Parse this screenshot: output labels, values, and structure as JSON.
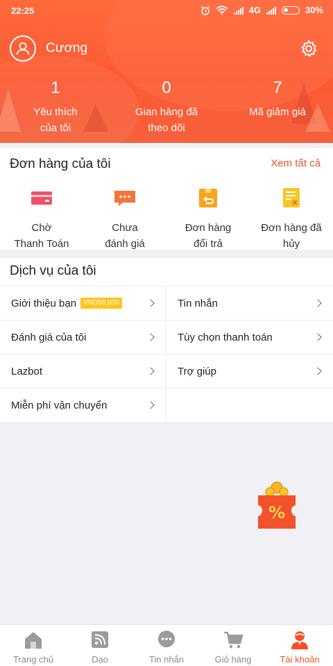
{
  "status_bar": {
    "time": "22:25",
    "network": "4G",
    "battery": "30%"
  },
  "header": {
    "username": "Cương",
    "stats": [
      {
        "value": "1",
        "label_line1": "Yêu thích",
        "label_line2": "của tôi"
      },
      {
        "value": "0",
        "label_line1": "Gian hàng đã",
        "label_line2": "theo dõi"
      },
      {
        "value": "7",
        "label_line1": "Mã giảm giá",
        "label_line2": ""
      }
    ]
  },
  "orders": {
    "title": "Đơn hàng của tôi",
    "see_all": "Xem tất cả",
    "items": [
      {
        "line1": "Chờ",
        "line2": "Thanh Toán",
        "icon": "card-icon"
      },
      {
        "line1": "Chưa",
        "line2": "đánh giá",
        "icon": "chat-icon"
      },
      {
        "line1": "Đơn hàng",
        "line2": "đổi trả",
        "icon": "return-box-icon"
      },
      {
        "line1": "Đơn hàng đã",
        "line2": "hủy",
        "icon": "cancelled-doc-icon"
      }
    ]
  },
  "services": {
    "title": "Dịch vụ của tôi",
    "items": [
      {
        "label": "Giới thiệu bạn",
        "badge": "VND50,000"
      },
      {
        "label": "Tin nhắn"
      },
      {
        "label": "Đánh giá của tôi"
      },
      {
        "label": "Tùy chọn thanh toán"
      },
      {
        "label": "Lazbot"
      },
      {
        "label": "Trợ giúp"
      },
      {
        "label": "Miễn phí vận chuyển"
      }
    ]
  },
  "bottom_nav": {
    "items": [
      {
        "label": "Trang chủ",
        "icon": "home-icon"
      },
      {
        "label": "Dạo",
        "icon": "feed-icon"
      },
      {
        "label": "Tin nhắn",
        "icon": "message-icon"
      },
      {
        "label": "Giỏ hàng",
        "icon": "cart-icon"
      },
      {
        "label": "Tài khoản",
        "icon": "account-icon"
      }
    ],
    "active_index": 4
  },
  "colors": {
    "accent": "#f5502a",
    "header_gradient_top": "#ff6a3c",
    "header_gradient_bottom": "#f6603a",
    "badge": "#ffc51c",
    "nav_inactive": "#8a8a8a"
  }
}
